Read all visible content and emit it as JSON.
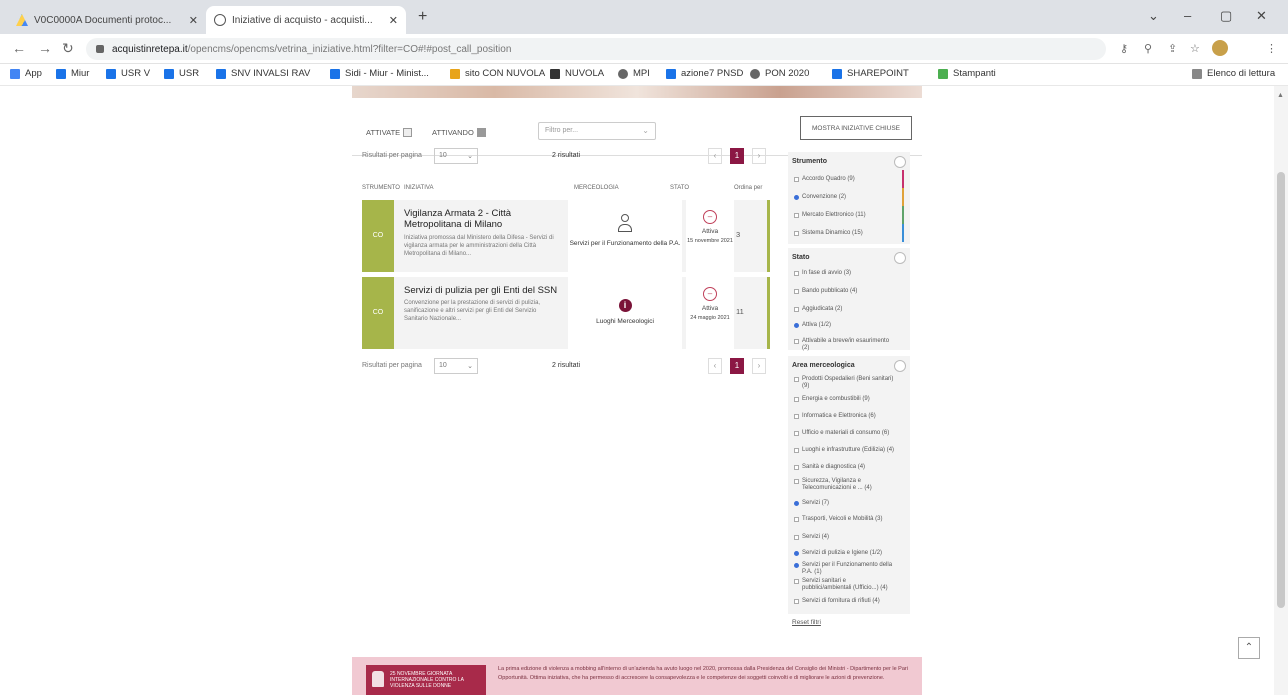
{
  "browser": {
    "tabs": [
      {
        "title": "V0C0000A Documenti protoc...",
        "active": false,
        "icon": "drive-icon"
      },
      {
        "title": "Iniziative di acquisto - acquisti...",
        "active": true,
        "icon": "globe-icon"
      }
    ],
    "new_tab": "+",
    "url_host": "acquistinretepa.it",
    "url_path": "/opencms/opencms/vetrina_iniziative.html?filter=CO#!#post_call_position",
    "bookmarks": [
      {
        "label": "App",
        "color": "#4285f4"
      },
      {
        "label": "Miur",
        "color": "#1a73e8"
      },
      {
        "label": "USR V",
        "color": "#1a73e8"
      },
      {
        "label": "USR",
        "color": "#1a73e8"
      },
      {
        "label": "SNV INVALSI RAV",
        "color": "#1a73e8"
      },
      {
        "label": "Sidi - Miur - Minist...",
        "color": "#1a73e8"
      },
      {
        "label": "sito CON NUVOLA",
        "color": "#e8a41a"
      },
      {
        "label": "NUVOLA",
        "color": "#333333"
      },
      {
        "label": "MPI",
        "color": "#666666"
      },
      {
        "label": "azione7 PNSD",
        "color": "#1a73e8"
      },
      {
        "label": "PON 2020",
        "color": "#666666"
      },
      {
        "label": "SHAREPOINT",
        "color": "#1a73e8"
      },
      {
        "label": "Stampanti",
        "color": "#4caf50"
      }
    ],
    "reading_list": "Elenco di lettura"
  },
  "filters": {
    "chk1": "ATTIVATE",
    "chk2": "ATTIVANDO",
    "dropdown": "Filtro per...",
    "button": "MOSTRA INIZIATIVE CHIUSE"
  },
  "pager": {
    "per_page_label": "Risultati per pagina",
    "per_page_value": "10",
    "results": "2 risultati",
    "current_page": "1"
  },
  "columns": {
    "c1": "STRUMENTO",
    "c2": "INIZIATIVA",
    "c3": "MERCEOLOGIA",
    "c4": "STATO",
    "c5": "Ordina per"
  },
  "cards": [
    {
      "badge": "CO",
      "title": "Vigilanza Armata 2 - Città Metropolitana di Milano",
      "desc": "Iniziativa promossa dal Ministero della Difesa - Servizi di vigilanza armata per le amministrazioni della Città Metropolitana di Milano...",
      "category": "Servizi per il Funzionamento della P.A.",
      "status": "Attiva",
      "date": "15 novembre 2021",
      "type": "3"
    },
    {
      "badge": "CO",
      "title": "Servizi di pulizia per gli Enti del SSN",
      "desc": "Convenzione per la prestazione di servizi di pulizia, sanificazione e altri servizi per gli Enti del Servizio Sanitario Nazionale...",
      "category": "Luoghi Merceologici",
      "status": "Attiva",
      "date": "24 maggio 2021",
      "type": "11"
    }
  ],
  "sidebar": {
    "strumento": {
      "title": "Strumento",
      "options": [
        {
          "label": "Accordo Quadro (9)",
          "on": false
        },
        {
          "label": "Convenzione (2)",
          "on": true
        },
        {
          "label": "Mercato Elettronico (11)",
          "on": false
        },
        {
          "label": "Sistema Dinamico (15)",
          "on": false
        }
      ],
      "stripe_colors": [
        "#c7306e",
        "#e0a23a",
        "#5fa36a",
        "#3a8fd8"
      ]
    },
    "stato": {
      "title": "Stato",
      "options": [
        {
          "label": "In fase di avvio (3)",
          "on": false
        },
        {
          "label": "Bando pubblicato (4)",
          "on": false
        },
        {
          "label": "Aggiudicata (2)",
          "on": false
        },
        {
          "label": "Attiva (1/2)",
          "on": true
        },
        {
          "label": "Attivabile a breve/in esaurimento (2)",
          "on": false
        }
      ]
    },
    "area": {
      "title": "Area merceologica",
      "options": [
        {
          "label": "Prodotti Ospedalieri (Beni sanitari) (9)",
          "on": false
        },
        {
          "label": "Energia e combustibili (9)",
          "on": false
        },
        {
          "label": "Informatica e Elettronica (6)",
          "on": false
        },
        {
          "label": "Ufficio e materiali di consumo (6)",
          "on": false
        },
        {
          "label": "Luoghi e infrastrutture (Edilizia) (4)",
          "on": false
        },
        {
          "label": "Sanità e diagnostica (4)",
          "on": false
        },
        {
          "label": "Sicurezza, Vigilanza e Telecomunicazioni e ... (4)",
          "on": false
        },
        {
          "label": "Servizi (7)",
          "on": true
        },
        {
          "label": "Trasporti, Veicoli e Mobilità (3)",
          "on": false
        },
        {
          "label": "Servizi (4)",
          "on": false
        },
        {
          "label": "Servizi di pulizia e Igiene (1/2)",
          "on": true
        },
        {
          "label": "Servizi per il Funzionamento della P.A. (1)",
          "on": true
        },
        {
          "label": "Servizi sanitari e pubblici/ambientali (Ufficio...) (4)",
          "on": false
        },
        {
          "label": "Servizi di fornitura di rifiuti (4)",
          "on": false
        }
      ]
    },
    "reset": "Reset filtri"
  },
  "footer": {
    "box": "25 NOVEMBRE GIORNATA INTERNAZIONALE CONTRO LA VIOLENZA SULLE DONNE",
    "text": "La prima edizione di violenza a mobbing all'interno di un'azienda ha avuto luogo nel 2020, promossa dalla Presidenza del Consiglio dei Ministri - Dipartimento per le Pari Opportunità. Ottima iniziativa, che ha permesso di accrescere la consapevolezza e le competenze dei soggetti coinvolti e di migliorare le azioni di prevenzione."
  }
}
